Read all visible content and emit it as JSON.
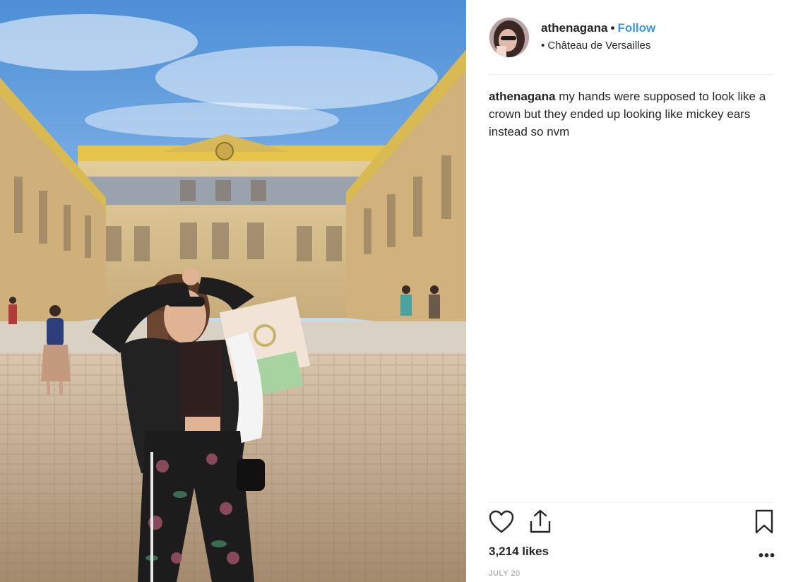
{
  "post": {
    "username": "athenagana",
    "separator": "•",
    "follow_label": "Follow",
    "location": "• Château de Versailles",
    "caption_user": "athenagana",
    "caption_text": " my hands were supposed to look like a crown but they ended up looking like mickey ears instead so nvm",
    "likes": "3,214 likes",
    "date": "JULY 20",
    "more_label": "•••"
  },
  "icons": {
    "like": "heart-icon",
    "share": "share-upload-icon",
    "save": "bookmark-icon",
    "more": "more-options-icon"
  },
  "colors": {
    "follow": "#3897f0",
    "text": "#262626",
    "muted": "#999999",
    "divider": "#efefef"
  }
}
